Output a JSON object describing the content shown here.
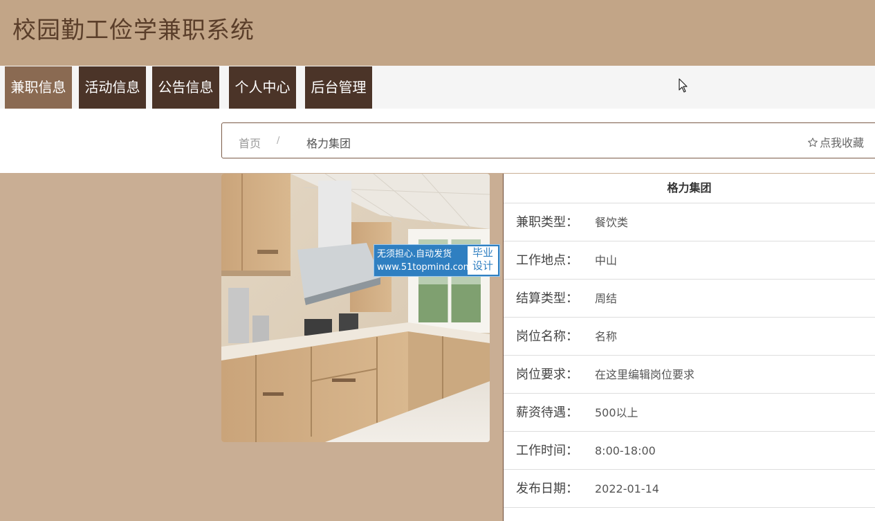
{
  "site": {
    "title": "校园勤工俭学兼职系统"
  },
  "nav": {
    "items": [
      {
        "label": "兼职信息",
        "active": true
      },
      {
        "label": "活动信息"
      },
      {
        "label": "公告信息"
      },
      {
        "label": "个人中心"
      },
      {
        "label": "后台管理"
      }
    ]
  },
  "breadcrumb": {
    "home": "首页",
    "separator": "/",
    "current": "格力集团",
    "favorite": "点我收藏"
  },
  "watermark": {
    "line1": "无须担心.自动发货",
    "line2": "www.51topmind.com",
    "badge_line1": "毕业",
    "badge_line2": "设计"
  },
  "detail": {
    "title": "格力集团",
    "rows": [
      {
        "label": "兼职类型：",
        "value": "餐饮类"
      },
      {
        "label": "工作地点：",
        "value": "中山"
      },
      {
        "label": "结算类型：",
        "value": "周结"
      },
      {
        "label": "岗位名称：",
        "value": "名称"
      },
      {
        "label": "岗位要求：",
        "value": "在这里编辑岗位要求"
      },
      {
        "label": "薪资待遇：",
        "value": "500以上"
      },
      {
        "label": "工作时间：",
        "value": "8:00-18:00"
      },
      {
        "label": "发布日期：",
        "value": "2022-01-14"
      }
    ]
  },
  "colors": {
    "header_bg": "#c2a587",
    "nav_bg": "#4b3428",
    "nav_active": "#8a6a52",
    "page_bg": "#c9ae94"
  }
}
